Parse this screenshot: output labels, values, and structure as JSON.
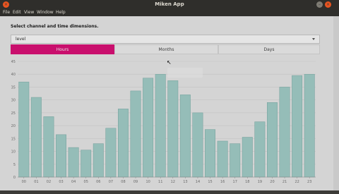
{
  "window": {
    "title": "Miken App",
    "controls": [
      "–",
      "□",
      "×"
    ]
  },
  "menu": [
    "File",
    "Edit",
    "View",
    "Window",
    "Help"
  ],
  "form": {
    "heading": "Select channel and time dimensions.",
    "channel_value": "level"
  },
  "tabs": [
    {
      "label": "Hours",
      "active": true
    },
    {
      "label": "Months",
      "active": false
    },
    {
      "label": "Days",
      "active": false
    }
  ],
  "colors": {
    "accent": "#e0117a",
    "bar": "#a6d3cd",
    "bar_stroke": "#7fb2ad",
    "window_close": "#e95420"
  },
  "chart_data": {
    "type": "bar",
    "categories": [
      "00",
      "01",
      "02",
      "03",
      "04",
      "05",
      "06",
      "07",
      "08",
      "09",
      "10",
      "11",
      "12",
      "13",
      "14",
      "15",
      "16",
      "17",
      "18",
      "19",
      "20",
      "21",
      "22",
      "23"
    ],
    "values": [
      37,
      31,
      23.5,
      16.5,
      11.5,
      10.5,
      13,
      19,
      26.5,
      33.5,
      38.5,
      40,
      37.5,
      32,
      25,
      18.5,
      14,
      13,
      15.5,
      21.5,
      29,
      35,
      39.5,
      40
    ],
    "ylim": [
      0,
      45
    ],
    "yticks": [
      0,
      5,
      10,
      15,
      20,
      25,
      30,
      35,
      40,
      45
    ],
    "grid": true
  }
}
